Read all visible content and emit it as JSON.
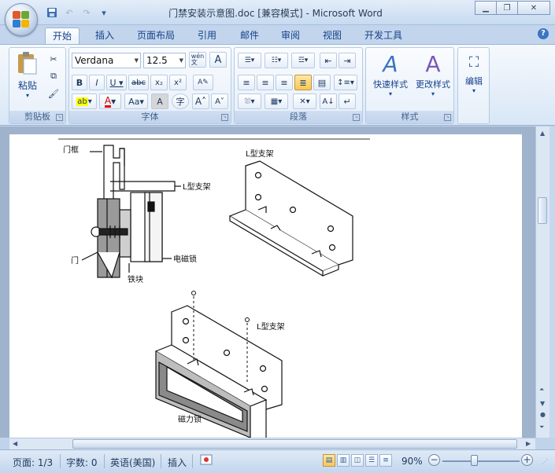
{
  "title_bar": {
    "title": "门禁安装示意图.doc [兼容模式] - Microsoft Word"
  },
  "tabs": [
    "开始",
    "插入",
    "页面布局",
    "引用",
    "邮件",
    "审阅",
    "视图",
    "开发工具"
  ],
  "ribbon": {
    "clipboard": {
      "label": "剪贴板",
      "paste": "粘贴"
    },
    "font": {
      "label": "字体",
      "font_name": "Verdana",
      "font_size": "12.5",
      "wen": "wén\n文",
      "aa": "Aa"
    },
    "paragraph": {
      "label": "段落"
    },
    "styles": {
      "label": "样式",
      "quick_styles": "快速样式",
      "change_styles": "更改样式"
    },
    "editing": {
      "label": "编辑"
    }
  },
  "document": {
    "labels": {
      "men_kuang": "门框",
      "l_bracket_1": "L型支架",
      "l_bracket_2": "L型支架",
      "l_bracket_3": "L型支架",
      "men": "门",
      "dian_ci_suo": "电磁锁",
      "tie_kuai": "铁块",
      "ci_li_suo": "磁力锁"
    }
  },
  "status_bar": {
    "page": "页面: 1/3",
    "words": "字数: 0",
    "language": "英语(美国)",
    "mode": "插入",
    "zoom": "90%"
  }
}
